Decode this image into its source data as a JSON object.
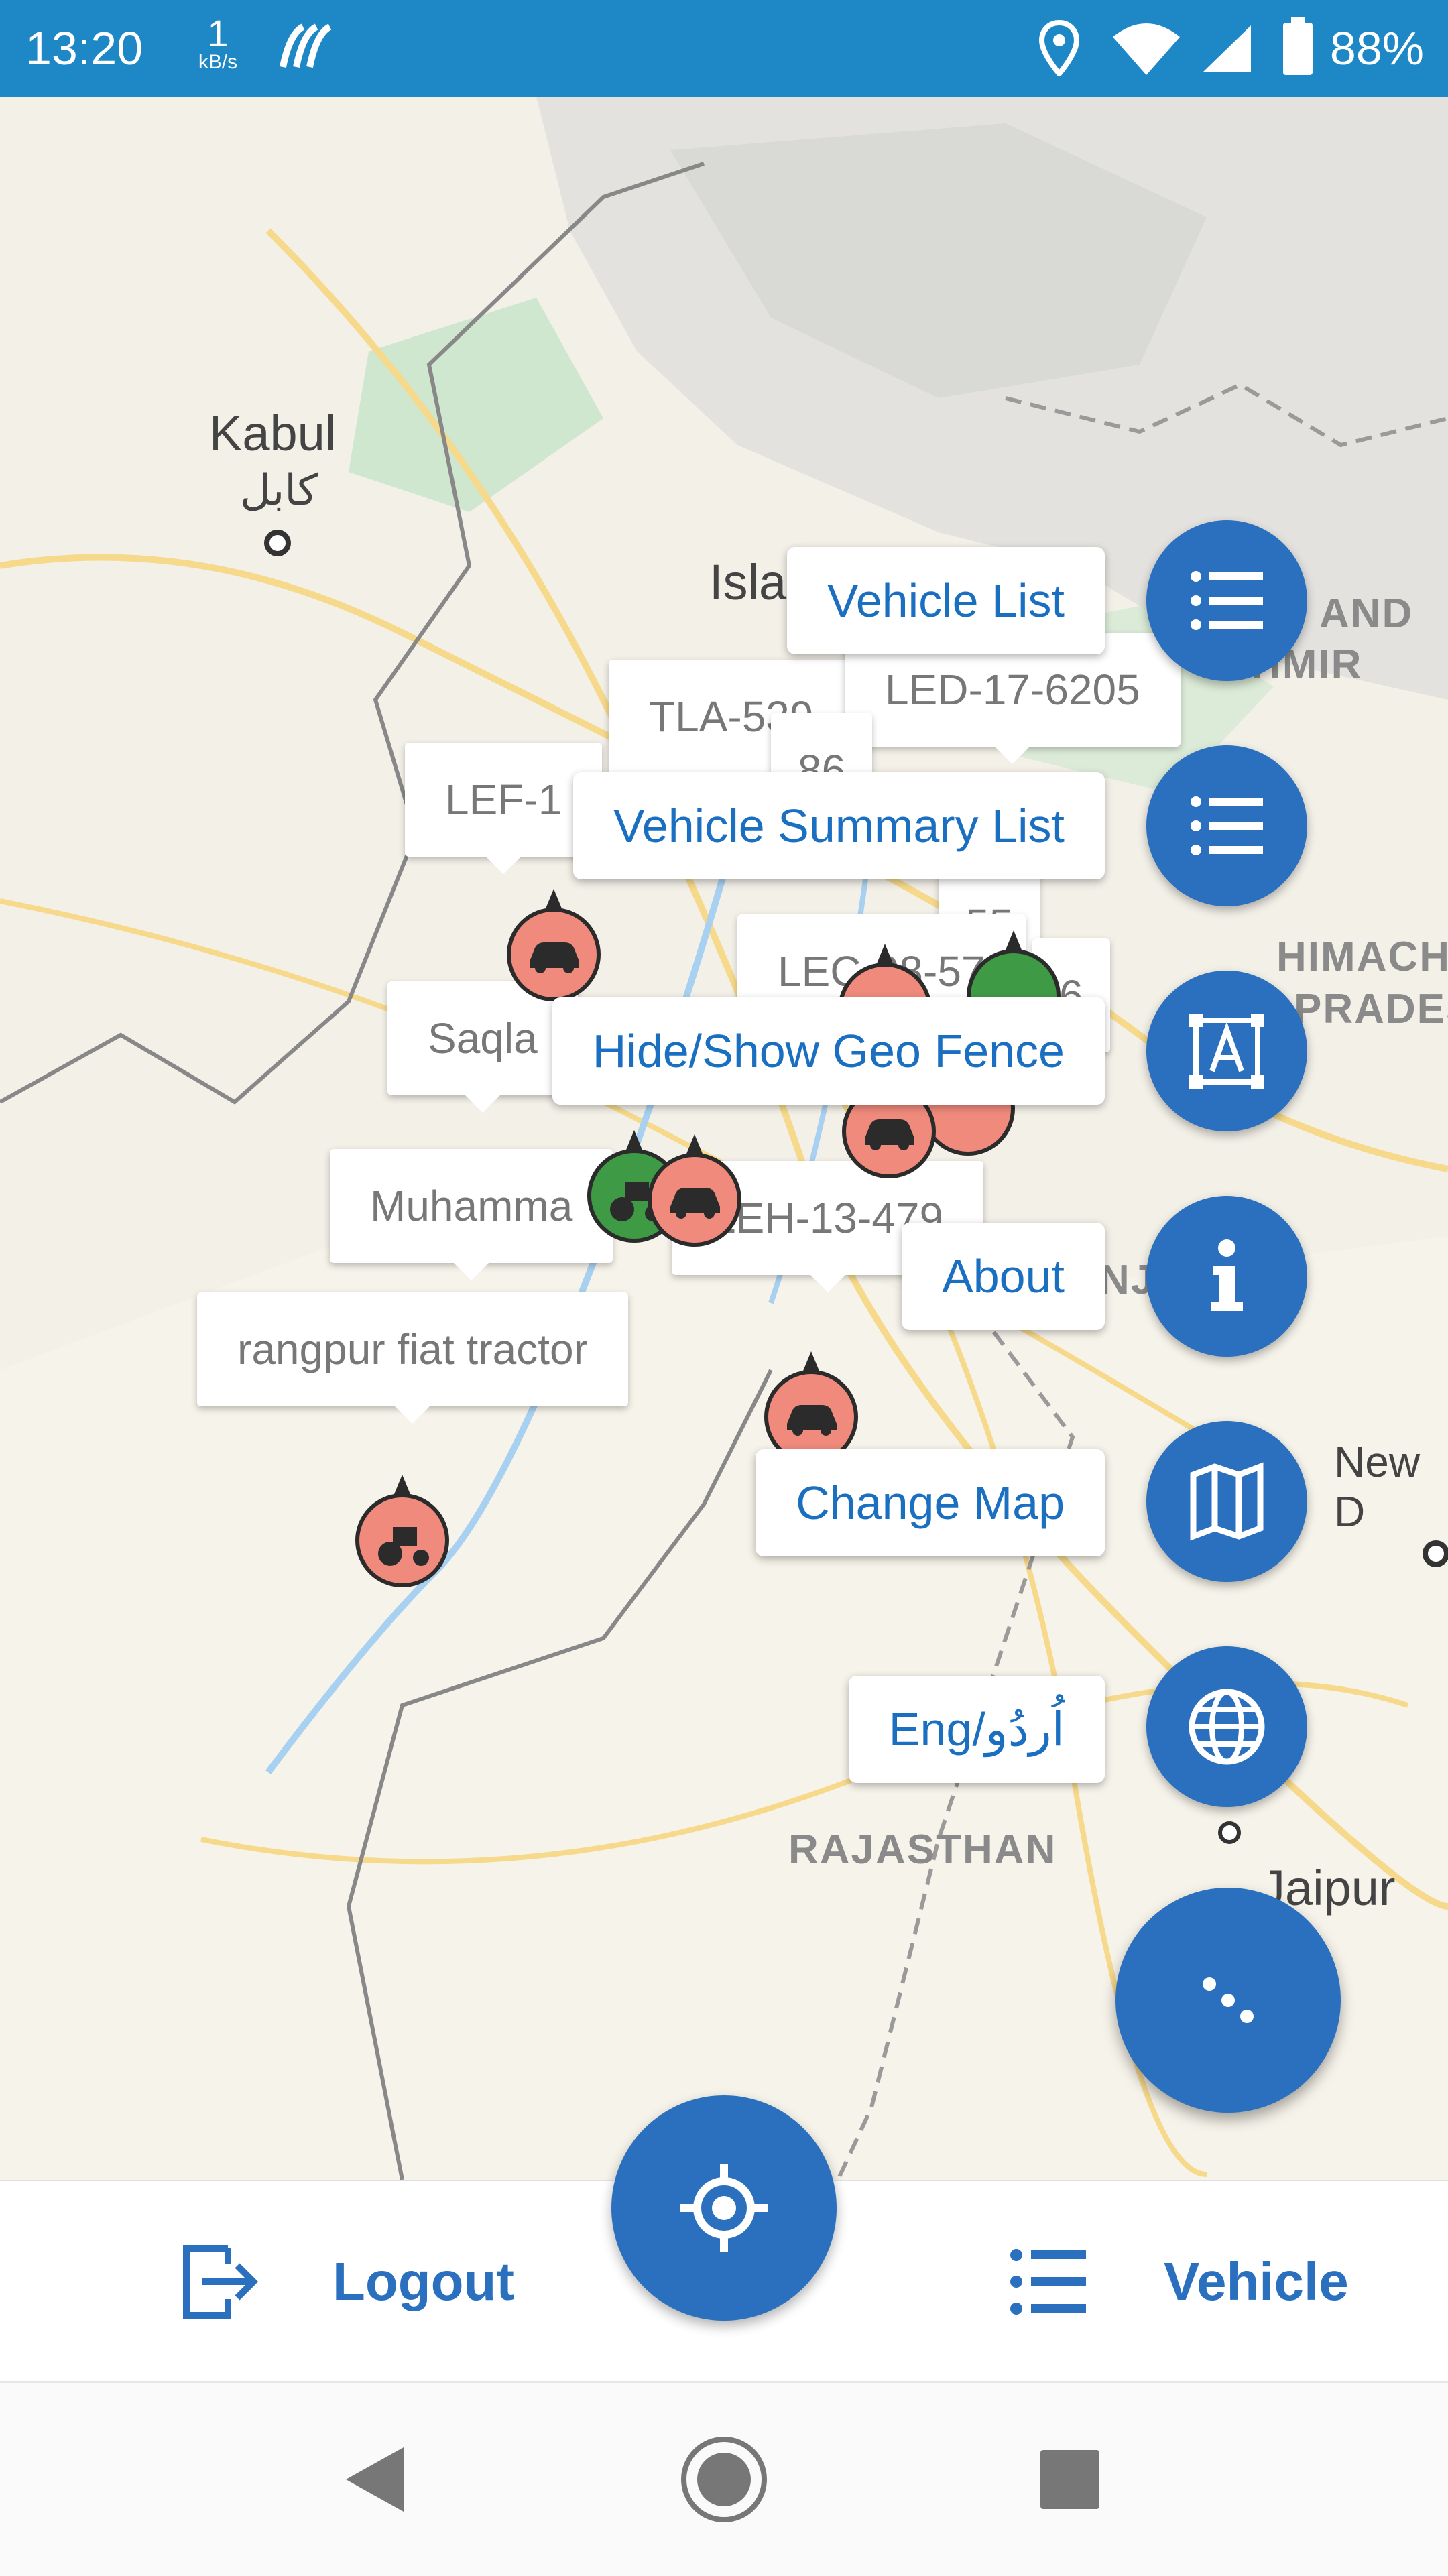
{
  "status_bar": {
    "time": "13:20",
    "speed_value": "1",
    "speed_unit": "kB/s",
    "battery": "88%"
  },
  "map": {
    "cities": [
      "Kabul",
      "كابل",
      "Isla",
      "New D",
      "Jaipur"
    ],
    "regions": [
      "AND",
      "HMIR",
      "HIMACH",
      "PRADES",
      "RAJASTHAN",
      "NJ"
    ],
    "callouts": {
      "c1": "TLA-539",
      "c2": "LED-17-6205",
      "c3": "LEF-1",
      "c4": "86",
      "c5": "55",
      "c6": "LEC-08-57",
      "c7": "6",
      "c8": "Saqla",
      "c9": "Muhamma",
      "c10": "LEH-13-479",
      "c11": "rangpur fiat tractor"
    }
  },
  "fab_menu": {
    "vehicle_list": "Vehicle List",
    "vehicle_summary_list": "Vehicle Summary List",
    "geo_fence": "Hide/Show Geo Fence",
    "about": "About",
    "change_map": "Change Map",
    "language": "Eng/اُردُو"
  },
  "bottom_bar": {
    "logout": "Logout",
    "vehicle": "Vehicle"
  },
  "colors": {
    "primary": "#2a70bf",
    "status_bar": "#1e88c7",
    "marker_red": "#f08a7c",
    "marker_green": "#3f9a45"
  }
}
